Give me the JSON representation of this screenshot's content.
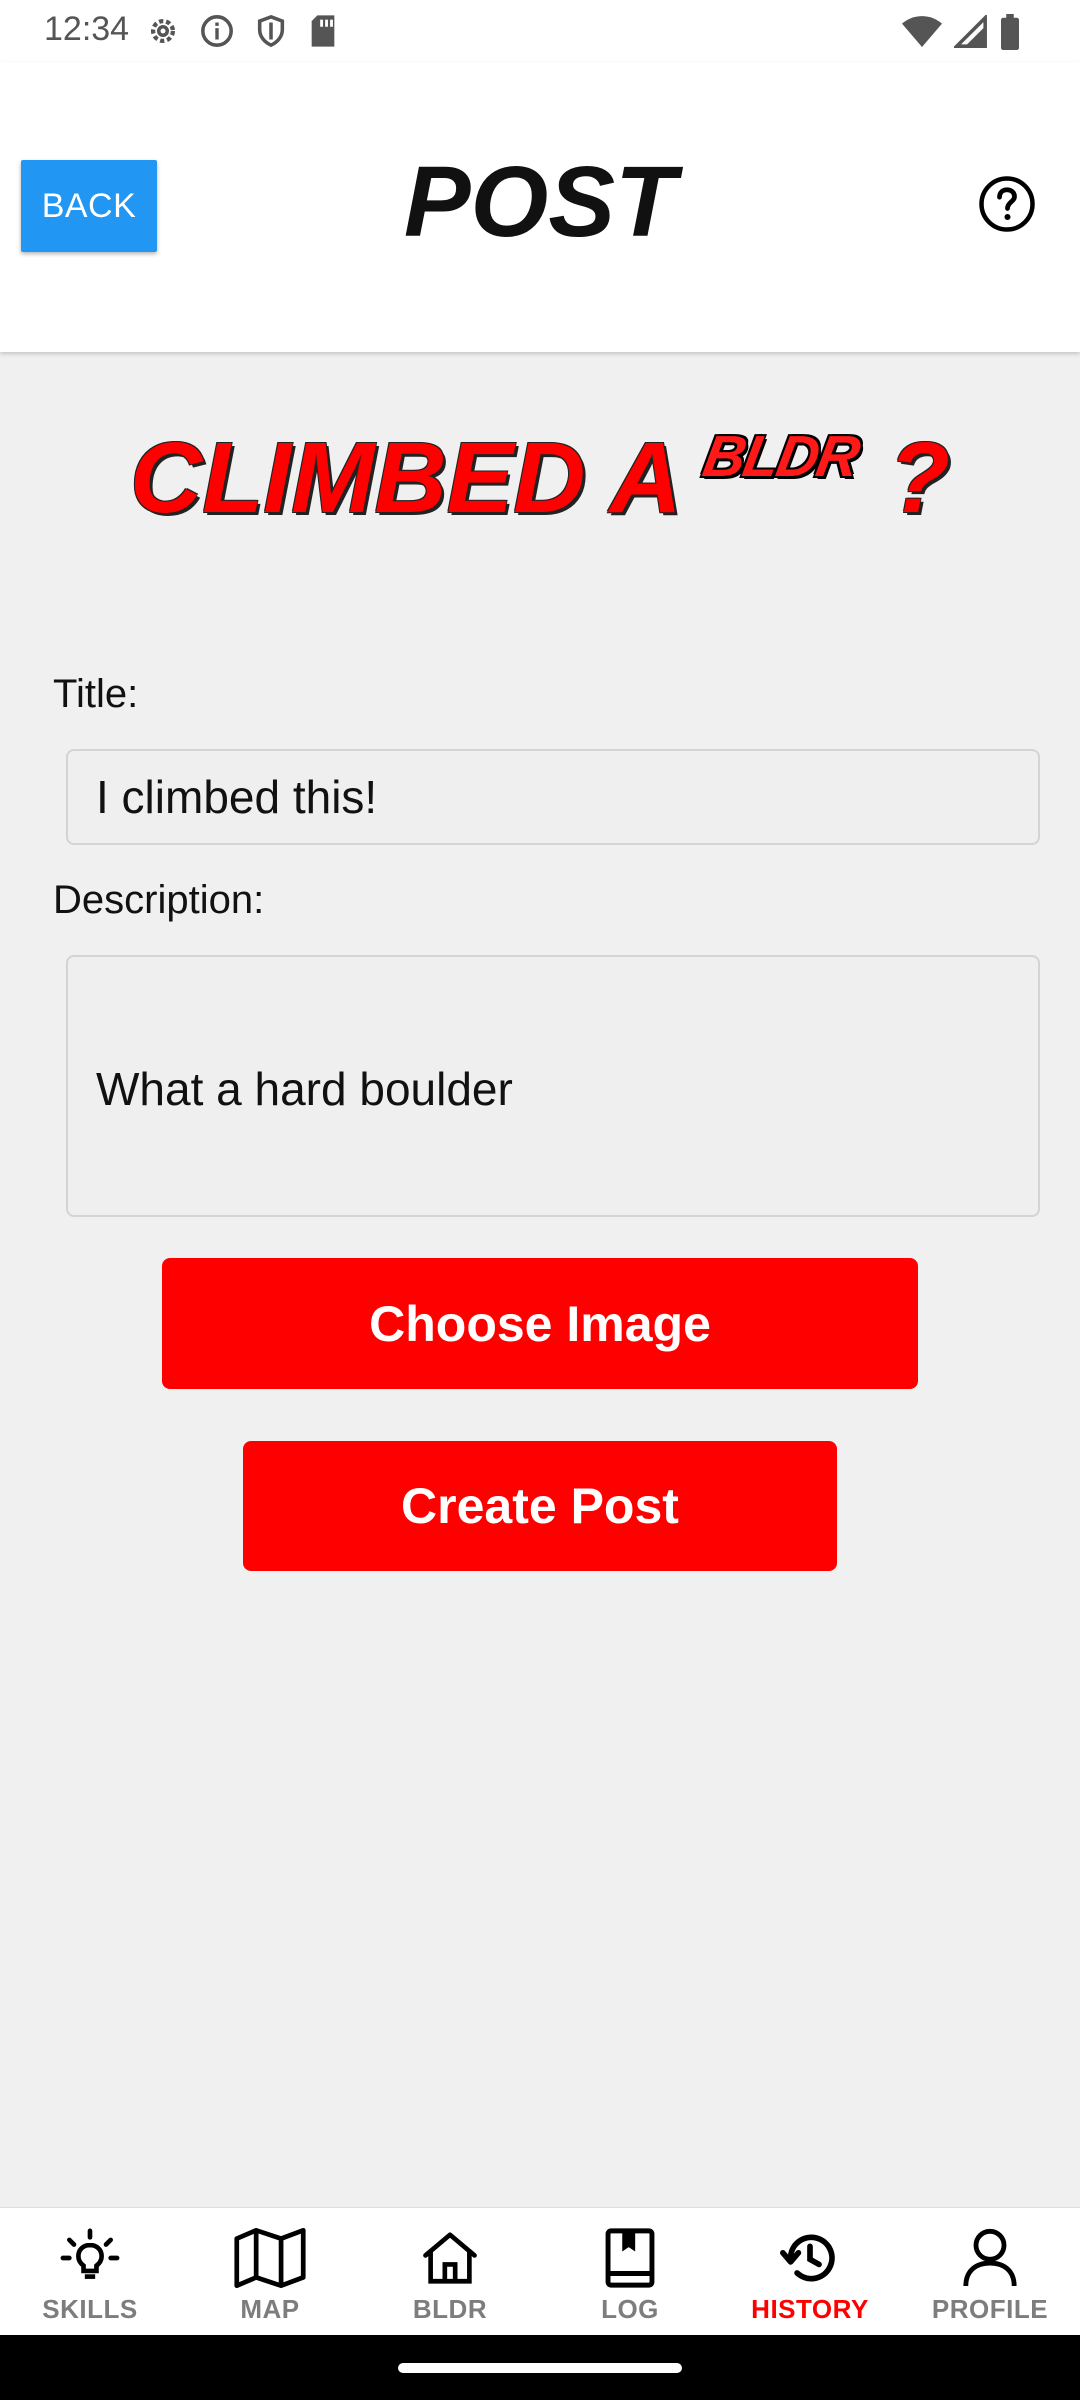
{
  "status_bar": {
    "time": "12:34",
    "left_icons": [
      "settings-gear-icon",
      "info-icon",
      "shield-icon",
      "sd-card-icon"
    ],
    "right_icons": [
      "wifi-icon",
      "cell-signal-icon",
      "battery-icon"
    ]
  },
  "header": {
    "back_label": "BACK",
    "title": "POST",
    "help_icon": "help-circle-icon"
  },
  "headline": {
    "text_before": "CLIMBED A",
    "logo_text": "BLDR",
    "text_after": "?"
  },
  "form": {
    "title_label": "Title:",
    "title_value": "I climbed this!",
    "description_label": "Description:",
    "description_value": "What a hard boulder",
    "choose_image_label": "Choose Image",
    "create_post_label": "Create Post"
  },
  "bottom_nav": {
    "active": "HISTORY",
    "items": [
      {
        "label": "SKILLS",
        "icon": "lightbulb-icon"
      },
      {
        "label": "MAP",
        "icon": "map-icon"
      },
      {
        "label": "BLDR",
        "icon": "home-icon"
      },
      {
        "label": "LOG",
        "icon": "book-icon"
      },
      {
        "label": "HISTORY",
        "icon": "history-icon"
      },
      {
        "label": "PROFILE",
        "icon": "profile-icon"
      }
    ]
  },
  "colors": {
    "accent_red": "#ff0000",
    "back_blue": "#2196f3",
    "background": "#f0f0f0"
  }
}
